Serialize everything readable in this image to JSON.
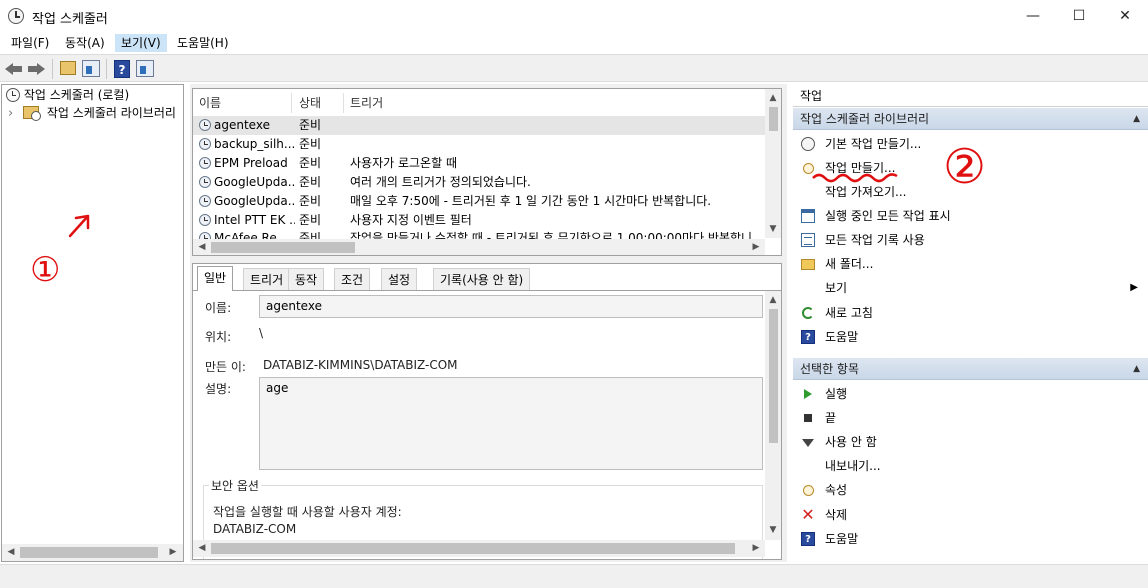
{
  "window": {
    "title": "작업 스케줄러",
    "controls": {
      "minimize": "—",
      "maximize": "☐",
      "close": "✕"
    }
  },
  "menu": [
    "파일(F)",
    "동작(A)",
    "보기(V)",
    "도움말(H)"
  ],
  "tree": {
    "root": "작업 스케줄러 (로컬)",
    "child": "작업 스케줄러 라이브러리",
    "expander": "›"
  },
  "task_list": {
    "columns": [
      "이름",
      "상태",
      "트리거"
    ],
    "rows": [
      {
        "name": "agentexe",
        "status": "준비",
        "trigger": ""
      },
      {
        "name": "backup_silh...",
        "status": "준비",
        "trigger": ""
      },
      {
        "name": "EPM Preload",
        "status": "준비",
        "trigger": "사용자가 로그온할 때"
      },
      {
        "name": "GoogleUpda...",
        "status": "준비",
        "trigger": "여러 개의 트리거가 정의되었습니다."
      },
      {
        "name": "GoogleUpda...",
        "status": "준비",
        "trigger": "매일 오후 7:50에 - 트리거된 후 1 일 기간 동안 1 시간마다 반복합니다."
      },
      {
        "name": "Intel PTT EK ...",
        "status": "준비",
        "trigger": "사용자 지정 이벤트 필터"
      },
      {
        "name": "McAfee Re...",
        "status": "준비",
        "trigger": "작업을 만들거나 수정할 때 - 트리거된 후 무기한으로 1.00:00:00마다 반복합니"
      }
    ]
  },
  "details": {
    "tabs": [
      "일반",
      "트리거",
      "동작",
      "조건",
      "설정",
      "기록(사용 안 함)"
    ],
    "name_label": "이름:",
    "name_value": "agentexe",
    "location_label": "위치:",
    "location_value": "\\",
    "author_label": "만든 이:",
    "author_value": "DATABIZ-KIMMINS\\DATABIZ-COM",
    "description_label": "설명:",
    "description_value": "age",
    "security_group": "보안 옵션",
    "security_text": "작업을 실행할 때 사용할 사용자 계정:",
    "security_account": "DATABIZ-COM"
  },
  "actions": {
    "title": "작업",
    "section1": {
      "header": "작업 스케줄러 라이브러리",
      "items": [
        {
          "label": "기본 작업 만들기...",
          "icon": "clock-plus-icon"
        },
        {
          "label": "작업 만들기...",
          "icon": "clock-icon"
        },
        {
          "label": "작업 가져오기...",
          "icon": ""
        },
        {
          "label": "실행 중인 모든 작업 표시",
          "icon": "list-icon"
        },
        {
          "label": "모든 작업 기록 사용",
          "icon": "doc-icon"
        },
        {
          "label": "새 폴더...",
          "icon": "folder-icon"
        },
        {
          "label": "보기",
          "icon": "",
          "submenu": "▶"
        },
        {
          "label": "새로 고침",
          "icon": "refresh-icon"
        },
        {
          "label": "도움말",
          "icon": "help-icon"
        }
      ]
    },
    "section2": {
      "header": "선택한 항목",
      "items": [
        {
          "label": "실행",
          "icon": "play-icon"
        },
        {
          "label": "끝",
          "icon": "stop-icon"
        },
        {
          "label": "사용 안 함",
          "icon": "down-arrow-icon"
        },
        {
          "label": "내보내기...",
          "icon": ""
        },
        {
          "label": "속성",
          "icon": "clock-icon"
        },
        {
          "label": "삭제",
          "icon": "delete-icon"
        },
        {
          "label": "도움말",
          "icon": "help-icon"
        }
      ]
    }
  },
  "annotations": {
    "one": "①",
    "two": "②"
  },
  "colors": {
    "selection": "#cce4f7",
    "section_header": "#d3deec",
    "annotation": "#e01010"
  }
}
